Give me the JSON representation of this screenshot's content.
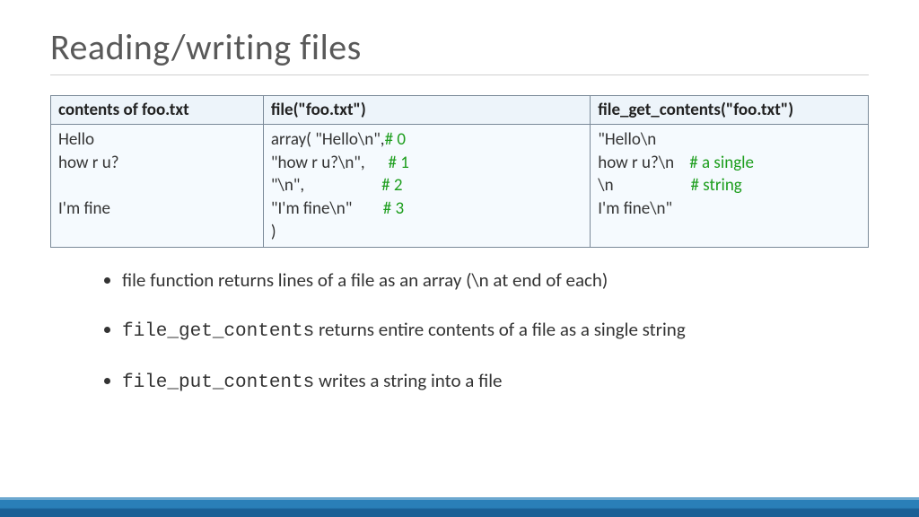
{
  "title": "Reading/writing files",
  "table": {
    "headers": [
      "contents of foo.txt",
      "file(\"foo.txt\")",
      "file_get_contents(\"foo.txt\")"
    ],
    "col1": [
      "Hello",
      "how r u?",
      "",
      "I'm fine",
      ""
    ],
    "col2": [
      {
        "left": "array( \"Hello\\n\",",
        "comment": "# 0"
      },
      {
        "left": "\"how r u?\\n\",",
        "comment": "# 1"
      },
      {
        "left": "\"\\n\",",
        "comment": "# 2"
      },
      {
        "left": "\"I'm fine\\n\"",
        "comment": "# 3"
      },
      {
        "left": ")",
        "comment": ""
      }
    ],
    "col3": [
      {
        "left": "\"Hello\\n",
        "comment": ""
      },
      {
        "left": "how r u?\\n",
        "comment": "# a single"
      },
      {
        "left": "\\n",
        "comment": "# string"
      },
      {
        "left": "I'm fine\\n\"",
        "comment": ""
      },
      {
        "left": "",
        "comment": ""
      }
    ]
  },
  "bullets": {
    "b1_pre": "file function returns lines of a file as an array (\\n at end of each)",
    "b2_code": "file_get_contents",
    "b2_rest": " returns entire contents of a file as a single string",
    "b3_code": "file_put_contents",
    "b3_rest": " writes a string into a file"
  }
}
